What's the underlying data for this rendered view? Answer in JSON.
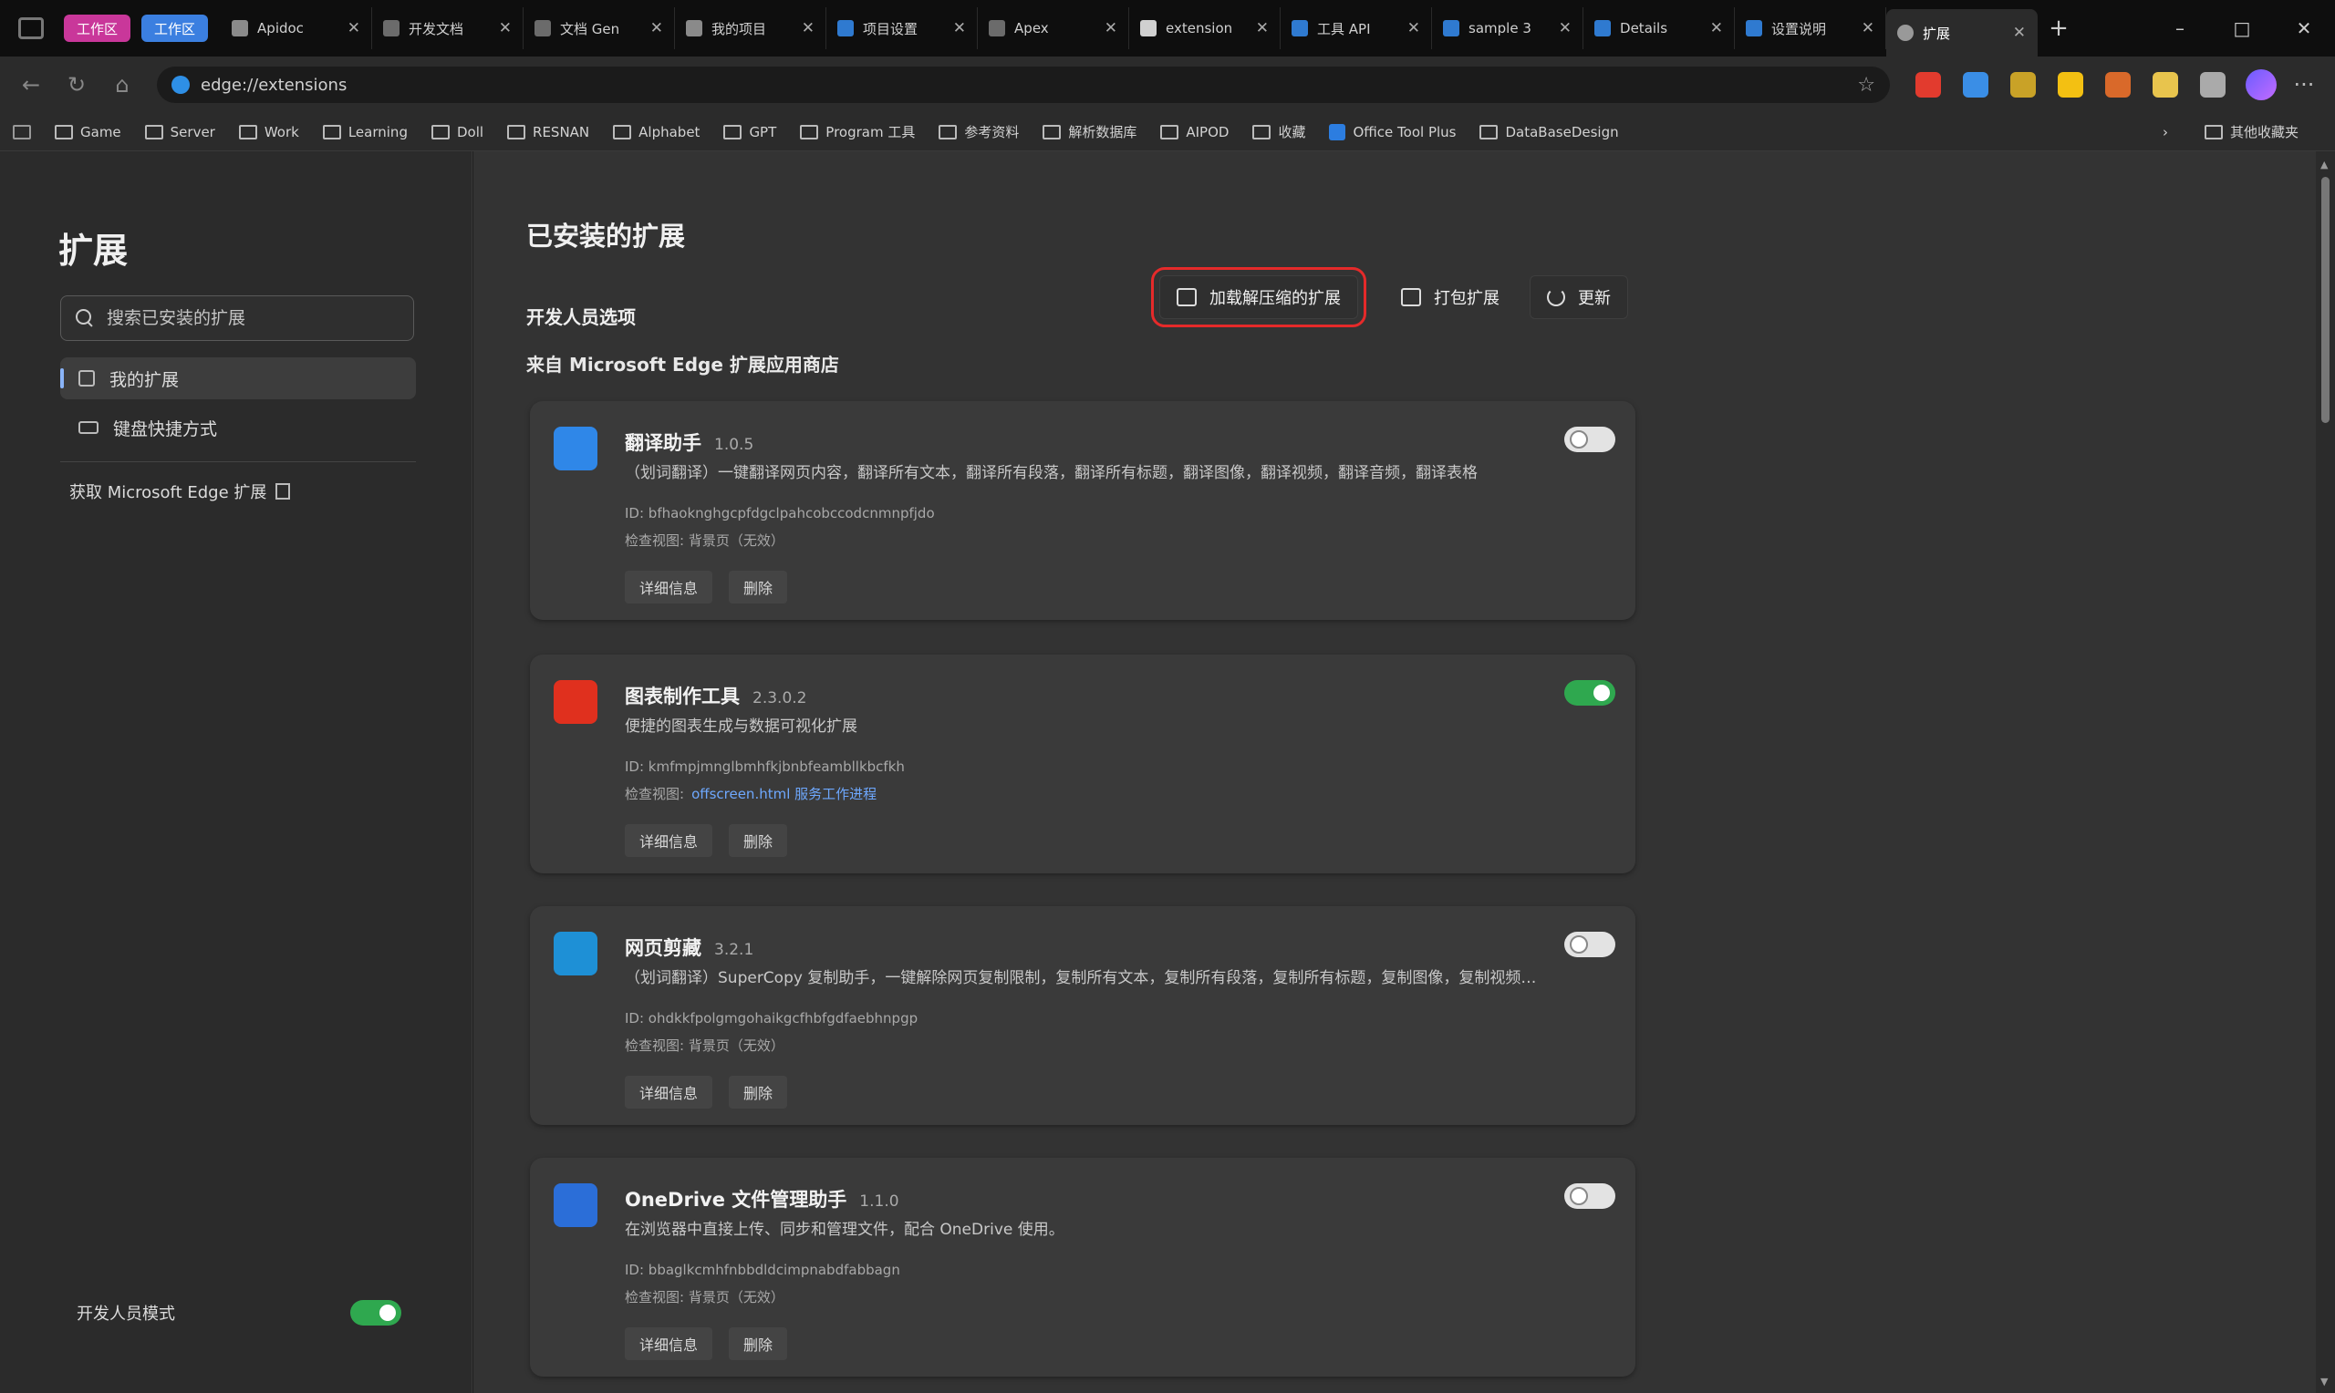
{
  "tabs": {
    "workspace_badges": [
      "工作区",
      "工作区"
    ],
    "items": [
      {
        "title": "Apidoc",
        "color": "#8a8a8a"
      },
      {
        "title": "开发文档",
        "color": "#6b6b6b"
      },
      {
        "title": "文档 Gen",
        "color": "#6b6b6b"
      },
      {
        "title": "我的项目",
        "color": "#8a8a8a"
      },
      {
        "title": "项目设置",
        "color": "#2f7ad0"
      },
      {
        "title": "Apex",
        "color": "#6b6b6b"
      },
      {
        "title": "extension",
        "color": "#d0d0d0"
      },
      {
        "title": "工具 API",
        "color": "#2f7ad0"
      },
      {
        "title": "sample 3",
        "color": "#2f7ad0"
      },
      {
        "title": "Details",
        "color": "#2f7ad0"
      },
      {
        "title": "设置说明",
        "color": "#2f7ad0"
      }
    ],
    "active_tab": "扩展",
    "new_tab_label": "+",
    "window": {
      "minimize": "–",
      "maximize": "□",
      "close": "✕"
    }
  },
  "toolbar": {
    "back": "←",
    "refresh": "↻",
    "home": "⌂",
    "url": "edge://extensions",
    "favorite_star": "☆",
    "extension_colors": [
      "#e23b2e",
      "#3a8ee6",
      "#c9a227",
      "#f3c012",
      "#d9692a",
      "#e8c44d",
      "#aaaaaa"
    ],
    "more": "···"
  },
  "favorites": {
    "items": [
      "Game",
      "Server",
      "Work",
      "Learning",
      "Doll",
      "RESNAN",
      "Alphabet",
      "GPT",
      "Program 工具",
      "参考资料",
      "解析数据库",
      "AIPOD",
      "收藏",
      "Office Tool Plus",
      "DataBaseDesign"
    ],
    "right_items": [
      "其他收藏夹"
    ]
  },
  "sidebar": {
    "title": "扩展",
    "search_placeholder": "搜索已安装的扩展",
    "items": [
      {
        "label": "我的扩展",
        "selected": true
      },
      {
        "label": "键盘快捷方式",
        "selected": false
      }
    ],
    "get_extensions_link": "获取 Microsoft Edge 扩展",
    "developer_mode_label": "开发人员模式",
    "developer_mode_on": true
  },
  "main": {
    "title": "已安装的扩展",
    "developer_options_label": "开发人员选项",
    "store_text": "来自 Microsoft Edge 扩展应用商店",
    "actions": {
      "load_unpacked": "加载解压缩的扩展",
      "pack": "打包扩展",
      "update": "更新"
    },
    "extensions": [
      {
        "name": "翻译助手",
        "version": "1.0.5",
        "description": "（划词翻译）一键翻译网页内容，翻译所有文本，翻译所有段落，翻译所有标题，翻译图像，翻译视频，翻译音频，翻译表格",
        "id": "ID: bfhaoknghgcpfdgclpahcobccodcnmnpfjdo",
        "source": "检查视图: 背景页（无效）",
        "source_link": "",
        "details": "详细信息",
        "remove": "删除",
        "enabled": false,
        "icon_color": "#2f87e8"
      },
      {
        "name": "图表制作工具",
        "version": "2.3.0.2",
        "description": "便捷的图表生成与数据可视化扩展",
        "id": "ID: kmfmpjmnglbmhfkjbnbfeambllkbcfkh",
        "source": "检查视图:",
        "source_link": "offscreen.html  服务工作进程",
        "details": "详细信息",
        "remove": "删除",
        "enabled": true,
        "icon_color": "#e0301e"
      },
      {
        "name": "网页剪藏",
        "version": "3.2.1",
        "description": "（划词翻译）SuperCopy 复制助手，一键解除网页复制限制，复制所有文本，复制所有段落，复制所有标题，复制图像，复制视频，复制音频",
        "id": "ID: ohdkkfpolgmgohaikgcfhbfgdfaebhnpgp",
        "source": "检查视图: 背景页（无效）",
        "source_link": "",
        "details": "详细信息",
        "remove": "删除",
        "enabled": false,
        "icon_color": "#1e90d6"
      },
      {
        "name": "OneDrive 文件管理助手",
        "version": "1.1.0",
        "description": "在浏览器中直接上传、同步和管理文件，配合 OneDrive 使用。",
        "id": "ID: bbaglkcmhfnbbdldcimpnabdfabbagn",
        "source": "检查视图: 背景页（无效）",
        "source_link": "",
        "details": "详细信息",
        "remove": "删除",
        "enabled": false,
        "icon_color": "#2b6ed8"
      }
    ]
  }
}
